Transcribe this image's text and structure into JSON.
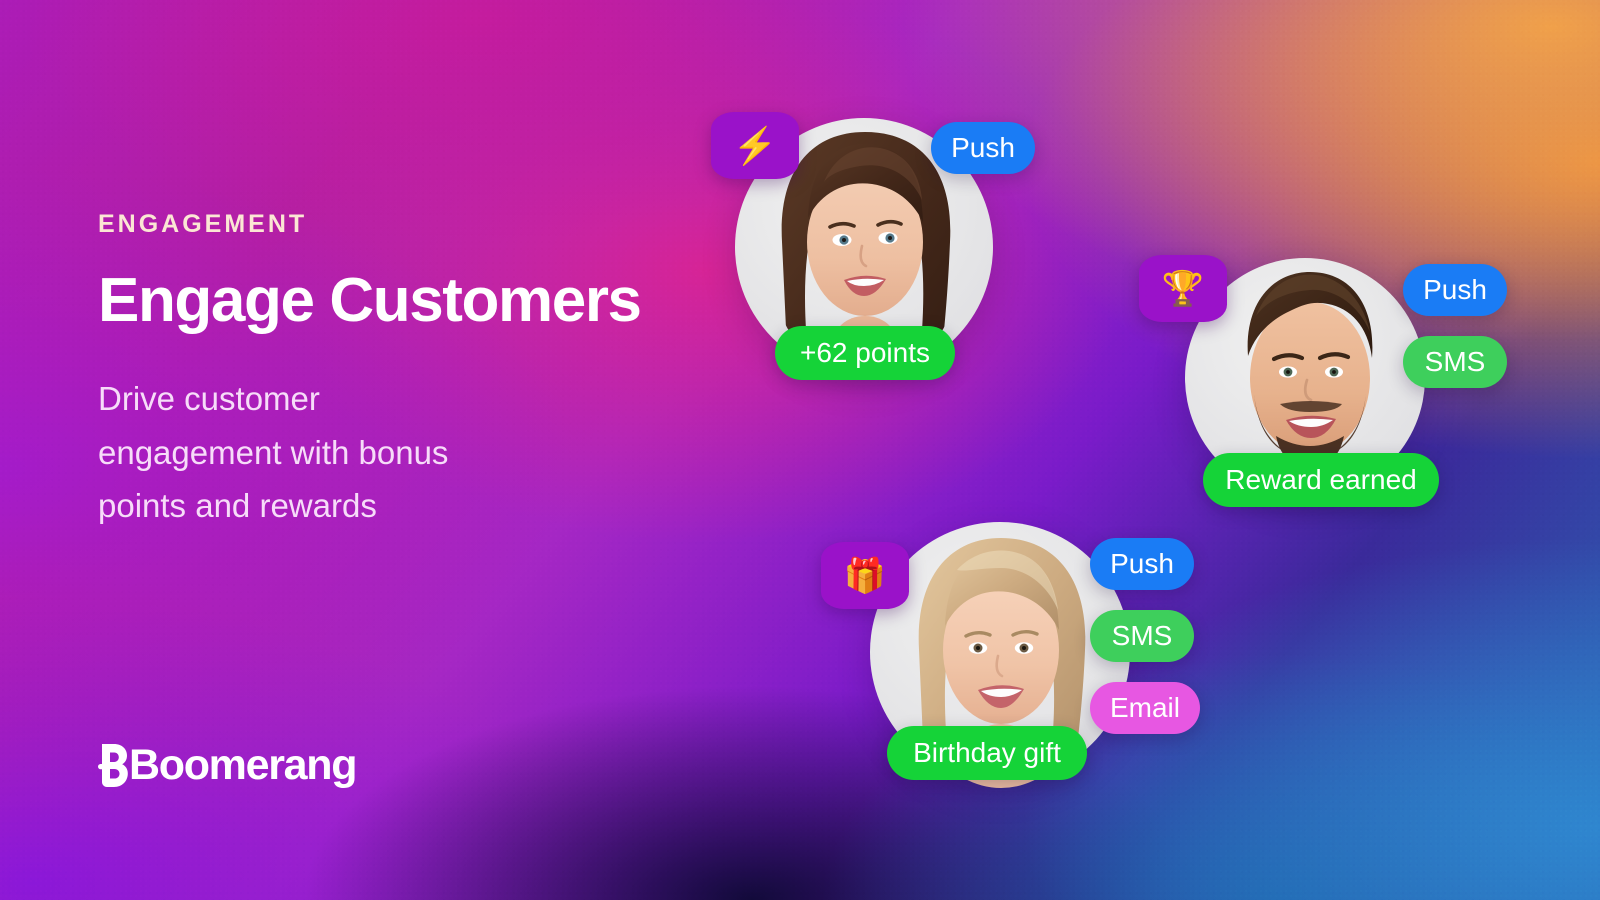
{
  "hero": {
    "eyebrow": "ENGAGEMENT",
    "headline": "Engage Customers",
    "subcopy": "Drive customer engagement with bonus points and rewards"
  },
  "brand": {
    "name": "Boomerang",
    "logo_icon": "boomerang-b-mark"
  },
  "colors": {
    "push": "#1a7cf5",
    "sms": "#3ecf5c",
    "email": "#e757e2",
    "status": "#15d338",
    "badge": "#9a12c9",
    "eyebrow_text": "#fbe6d4",
    "headline_text": "#ffffff",
    "subcopy_text": "#f7dcf9"
  },
  "clusters": [
    {
      "id": "cluster-1",
      "avatar": "woman-brown-hair-avatar",
      "badge_icon": "lightning-bolt-icon",
      "badge_glyph": "⚡",
      "channels": [
        {
          "label": "Push",
          "type": "push"
        }
      ],
      "status": "+62 points"
    },
    {
      "id": "cluster-2",
      "avatar": "man-beard-avatar",
      "badge_icon": "trophy-icon",
      "badge_glyph": "🏆",
      "channels": [
        {
          "label": "Push",
          "type": "push"
        },
        {
          "label": "SMS",
          "type": "sms"
        }
      ],
      "status": "Reward earned"
    },
    {
      "id": "cluster-3",
      "avatar": "woman-blonde-avatar",
      "badge_icon": "gift-icon",
      "badge_glyph": "🎁",
      "channels": [
        {
          "label": "Push",
          "type": "push"
        },
        {
          "label": "SMS",
          "type": "sms"
        },
        {
          "label": "Email",
          "type": "email"
        }
      ],
      "status": "Birthday gift"
    }
  ]
}
